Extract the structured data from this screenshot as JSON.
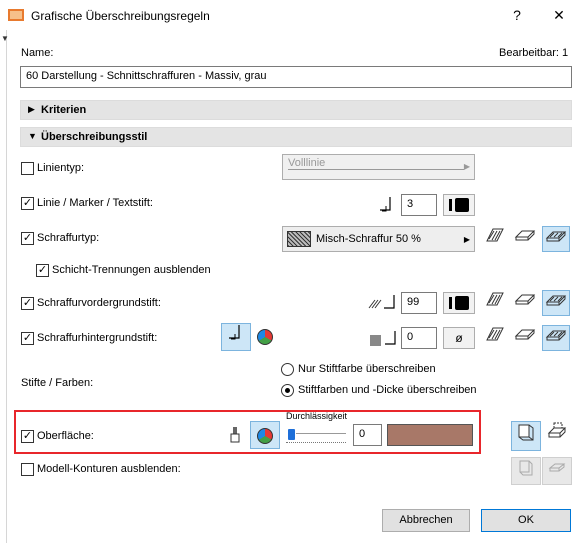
{
  "window": {
    "title": "Grafische Überschreibungsregeln",
    "help_glyph": "?",
    "close_glyph": "✕"
  },
  "name_row": {
    "label": "Name:",
    "editable": "Bearbeitbar: 1",
    "value": "60 Darstellung - Schnittschraffuren - Massiv, grau"
  },
  "sections": {
    "criteria": "Kriterien",
    "style": "Überschreibungsstil"
  },
  "rows": {
    "linetype": {
      "label": "Linientyp:",
      "checked": false,
      "dropdown": "Volllinie"
    },
    "line_pen": {
      "label": "Linie / Marker / Textstift:",
      "checked": true,
      "pen_value": "3"
    },
    "fill_type": {
      "label": "Schraffurtyp:",
      "checked": true,
      "dropdown": "Misch-Schraffur 50 %"
    },
    "hide_layers": {
      "label": "Schicht-Trennungen ausblenden",
      "checked": true
    },
    "fg_pen": {
      "label": "Schraffurvordergrundstift:",
      "checked": true,
      "pen_value": "99"
    },
    "bg_pen": {
      "label": "Schraffurhintergrundstift:",
      "checked": true,
      "pen_value": "0",
      "null_glyph": "ø"
    },
    "pens_colors": {
      "label": "Stifte / Farben:",
      "option1": "Nur Stiftfarbe überschreiben",
      "option2": "Stiftfarben und -Dicke überschreiben",
      "selected": 2
    },
    "surface": {
      "label": "Oberfläche:",
      "checked": true,
      "transparency_label": "Durchlässigkeit",
      "transparency_value": "0",
      "color": "#a87868"
    },
    "model_contours": {
      "label": "Modell-Konturen ausblenden:",
      "checked": false
    }
  },
  "check_glyph": "✓",
  "buttons": {
    "cancel": "Abbrechen",
    "ok": "OK"
  },
  "colors": {
    "highlight": "#e8262b",
    "selected_button": "#cde6f7",
    "primary_border": "#0078d7"
  }
}
